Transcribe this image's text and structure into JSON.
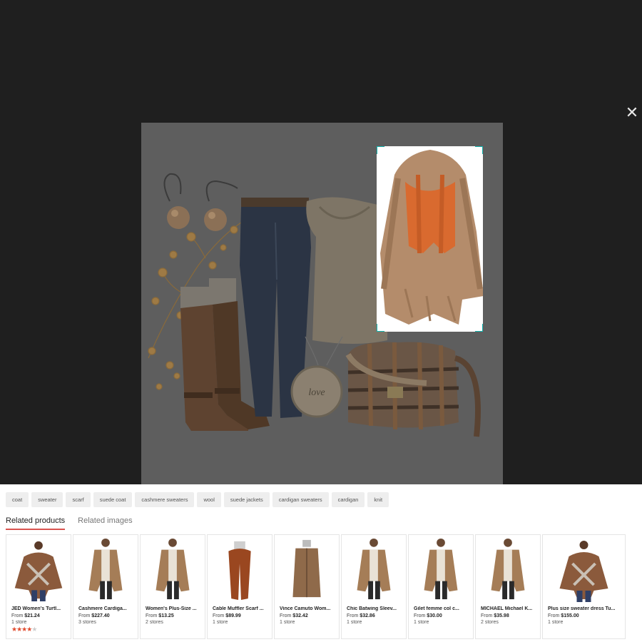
{
  "viewer": {
    "close_glyph": "✕",
    "background": "#1f1f1f",
    "selection_color": "#12b5b0",
    "preview_items": [
      "earrings",
      "boots",
      "jeans",
      "top",
      "cardigan with scarf",
      "pendant necklace",
      "plaid bag"
    ],
    "pendant_text": "love"
  },
  "chips": [
    "coat",
    "sweater",
    "scarf",
    "suede coat",
    "cashmere sweaters",
    "wool",
    "suede jackets",
    "cardigan sweaters",
    "cardigan",
    "knit"
  ],
  "tabs": [
    {
      "label": "Related products",
      "active": true
    },
    {
      "label": "Related images",
      "active": false
    }
  ],
  "accent_color": "#d9534f",
  "products": [
    {
      "title": "JED Women's Turtl...",
      "from": "From",
      "price": "$21.24",
      "stores": "1 store",
      "rating": 4,
      "image": "poncho"
    },
    {
      "title": "Cashmere Cardiga...",
      "from": "From",
      "price": "$227.40",
      "stores": "3 stores",
      "image": "cardigan"
    },
    {
      "title": "Women's Plus-Size ...",
      "from": "From",
      "price": "$13.25",
      "stores": "2 stores",
      "image": "cardigan"
    },
    {
      "title": "Cable Muffler Scarf ...",
      "from": "From",
      "price": "$89.99",
      "stores": "1 store",
      "image": "scarf"
    },
    {
      "title": "Vince Camuto Wom...",
      "from": "From",
      "price": "$32.42",
      "stores": "1 store",
      "image": "coat"
    },
    {
      "title": "Chic Batwing Sleev...",
      "from": "From",
      "price": "$32.86",
      "stores": "1 store",
      "image": "cardigan"
    },
    {
      "title": "Gilet femme col c...",
      "from": "From",
      "price": "$30.00",
      "stores": "1 store",
      "image": "cardigan"
    },
    {
      "title": "MICHAEL Michael K...",
      "from": "From",
      "price": "$35.98",
      "stores": "2 stores",
      "image": "cardigan"
    },
    {
      "title": "Plus size sweater dress Tu...",
      "from": "From",
      "price": "$155.00",
      "stores": "1 store",
      "image": "poncho"
    }
  ]
}
